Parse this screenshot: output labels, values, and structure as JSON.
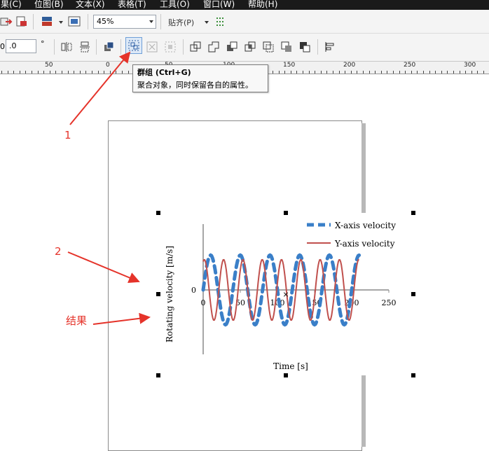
{
  "menu": [
    "果(C)",
    "位图(B)",
    "文本(X)",
    "表格(T)",
    "工具(O)",
    "窗口(W)",
    "帮助(H)"
  ],
  "toolbar": {
    "zoom_value": "45%",
    "snap_label": "贴齐(P)",
    "rotation_value": ".0",
    "degree_symbol": "°"
  },
  "ruler": {
    "labels": [
      "50",
      "0",
      "50",
      "100",
      "150",
      "200",
      "250",
      "300"
    ]
  },
  "tooltip": {
    "title": "群组 (Ctrl+G)",
    "description": "聚合对象，同时保留各自的属性。"
  },
  "annotations": {
    "one": "1",
    "two": "2",
    "result": "结果"
  },
  "chart_data": {
    "type": "line",
    "xlabel": "Time [s]",
    "ylabel": "Rotating velocity [m/s]",
    "x_ticks": [
      "0",
      "50",
      "100",
      "150",
      "200",
      "250"
    ],
    "y_ticks": [
      "0"
    ],
    "xlim": [
      0,
      250
    ],
    "legend_position": "top-right",
    "series": [
      {
        "name": "X-axis velocity",
        "color": "#3a7fc8",
        "style": "dashed",
        "amplitude": 0.8,
        "period": 40,
        "phase": 0.0
      },
      {
        "name": "Y-axis velocity",
        "color": "#c0504d",
        "style": "solid",
        "amplitude": 0.7,
        "period": 26,
        "phase": 1.2
      }
    ]
  }
}
